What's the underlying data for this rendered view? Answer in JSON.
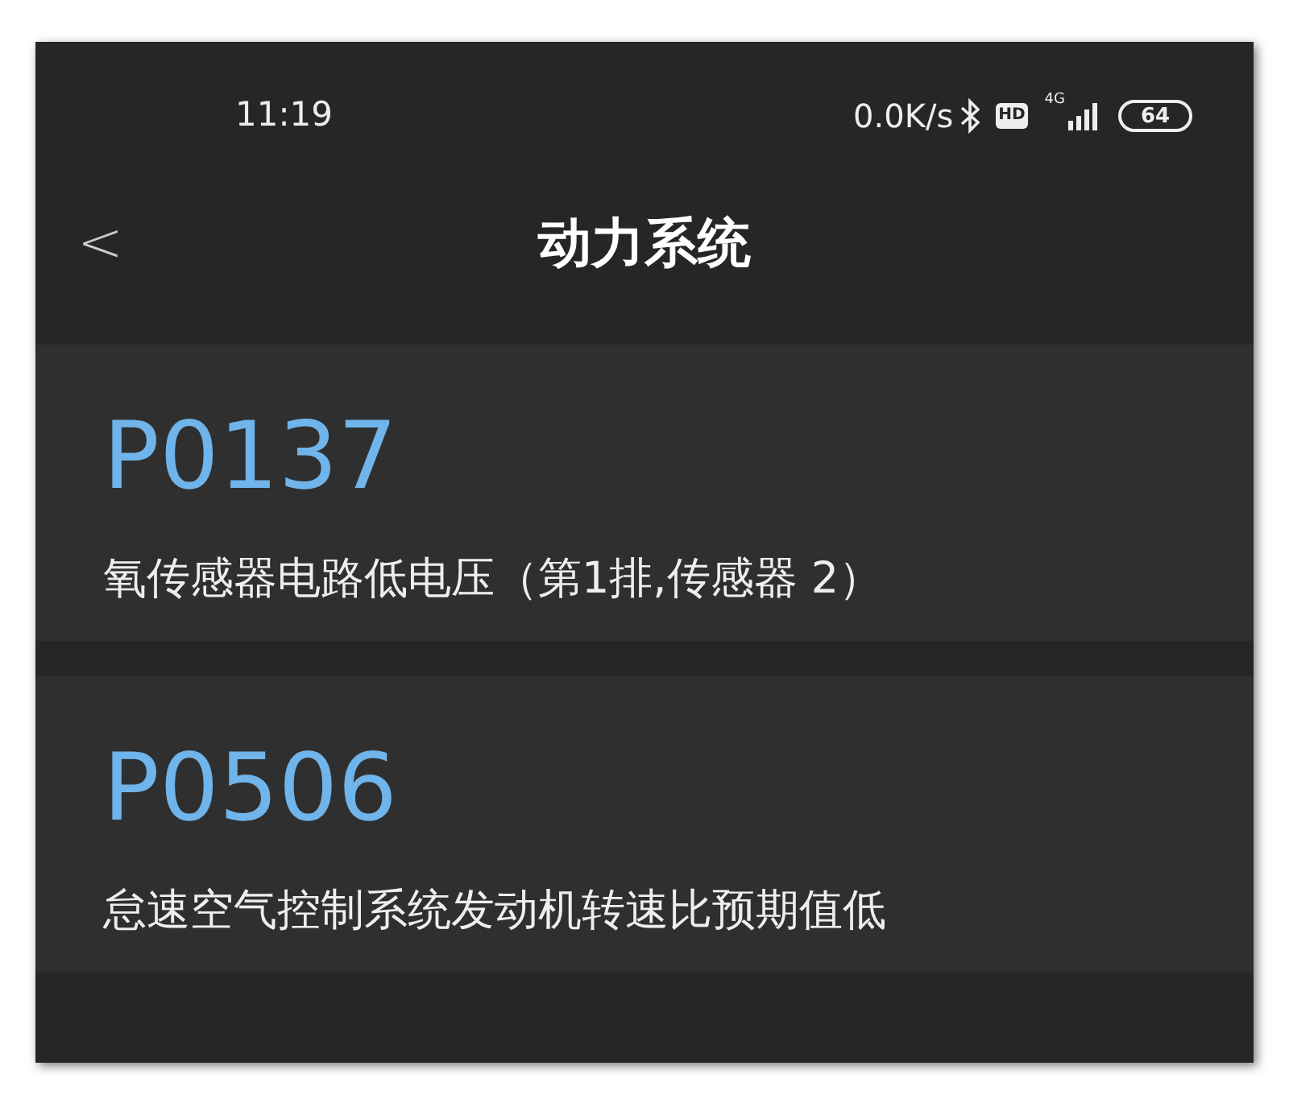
{
  "status_bar": {
    "time": "11:19",
    "speed": "0.0K/s",
    "hd": "HD",
    "network": "4G",
    "battery": "64"
  },
  "header": {
    "back": "<",
    "title": "动力系统"
  },
  "codes": [
    {
      "code": "P0137",
      "description": "氧传感器电路低电压（第1排,传感器 2）"
    },
    {
      "code": "P0506",
      "description": "怠速空气控制系统发动机转速比预期值低"
    }
  ]
}
